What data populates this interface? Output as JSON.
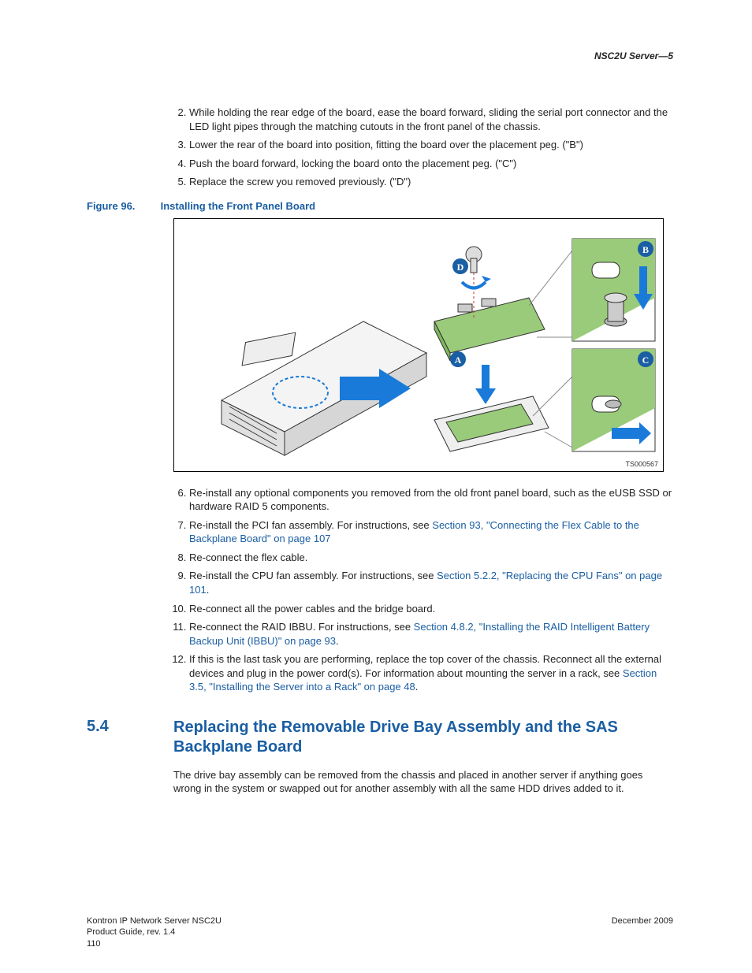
{
  "running_head": "NSC2U Server—5",
  "steps_a": [
    {
      "n": "2.",
      "t": "While holding the rear edge of the board, ease the board forward, sliding the serial port connector and the LED light pipes through the matching cutouts in the front panel of the chassis."
    },
    {
      "n": "3.",
      "t": "Lower the rear of the board into position, fitting the board over the placement peg. (\"B\")"
    },
    {
      "n": "4.",
      "t": "Push the board forward, locking the board onto the placement peg. (\"C\")"
    },
    {
      "n": "5.",
      "t": "Replace the screw you removed previously. (\"D\")"
    }
  ],
  "figure": {
    "label_num": "Figure 96.",
    "label_title": "Installing the Front Panel Board",
    "id": "TS000567",
    "callouts": {
      "a": "A",
      "b": "B",
      "c": "C",
      "d": "D"
    }
  },
  "steps_b": [
    {
      "n": "6.",
      "pre": "Re-install any optional components you removed from the old front panel board, such as the eUSB SSD or hardware RAID 5 components.",
      "link": "",
      "post": ""
    },
    {
      "n": "7.",
      "pre": "Re-install the PCI fan assembly. For instructions, see ",
      "link": "Section 93, \"Connecting the Flex Cable to the Backplane Board\" on page 107",
      "post": ""
    },
    {
      "n": "8.",
      "pre": "Re-connect the flex cable.",
      "link": "",
      "post": ""
    },
    {
      "n": "9.",
      "pre": "Re-install the CPU fan assembly. For instructions, see ",
      "link": "Section 5.2.2, \"Replacing the CPU Fans\" on page 101",
      "post": "."
    },
    {
      "n": "10.",
      "pre": "Re-connect all the power cables and the bridge board.",
      "link": "",
      "post": ""
    },
    {
      "n": "11.",
      "pre": "Re-connect the RAID IBBU. For instructions, see ",
      "link": "Section 4.8.2, \"Installing the RAID Intelligent Battery Backup Unit (IBBU)\" on page 93",
      "post": "."
    },
    {
      "n": "12.",
      "pre": "If this is the last task you are performing, replace the top cover of the chassis. Reconnect all the external devices and plug in the power cord(s).\nFor information about mounting the server in a rack, see ",
      "link": "Section 3.5, \"Installing the Server into a Rack\" on page 48",
      "post": "."
    }
  ],
  "section": {
    "num": "5.4",
    "title": "Replacing the Removable Drive Bay Assembly and the SAS Backplane Board",
    "body": "The drive bay assembly can be removed from the chassis and placed in another server if anything goes wrong in the system or swapped out for another assembly with all the same HDD drives added to it."
  },
  "footer": {
    "line1": "Kontron IP Network Server NSC2U",
    "line2": "Product Guide, rev. 1.4",
    "page": "110",
    "date": "December 2009"
  }
}
